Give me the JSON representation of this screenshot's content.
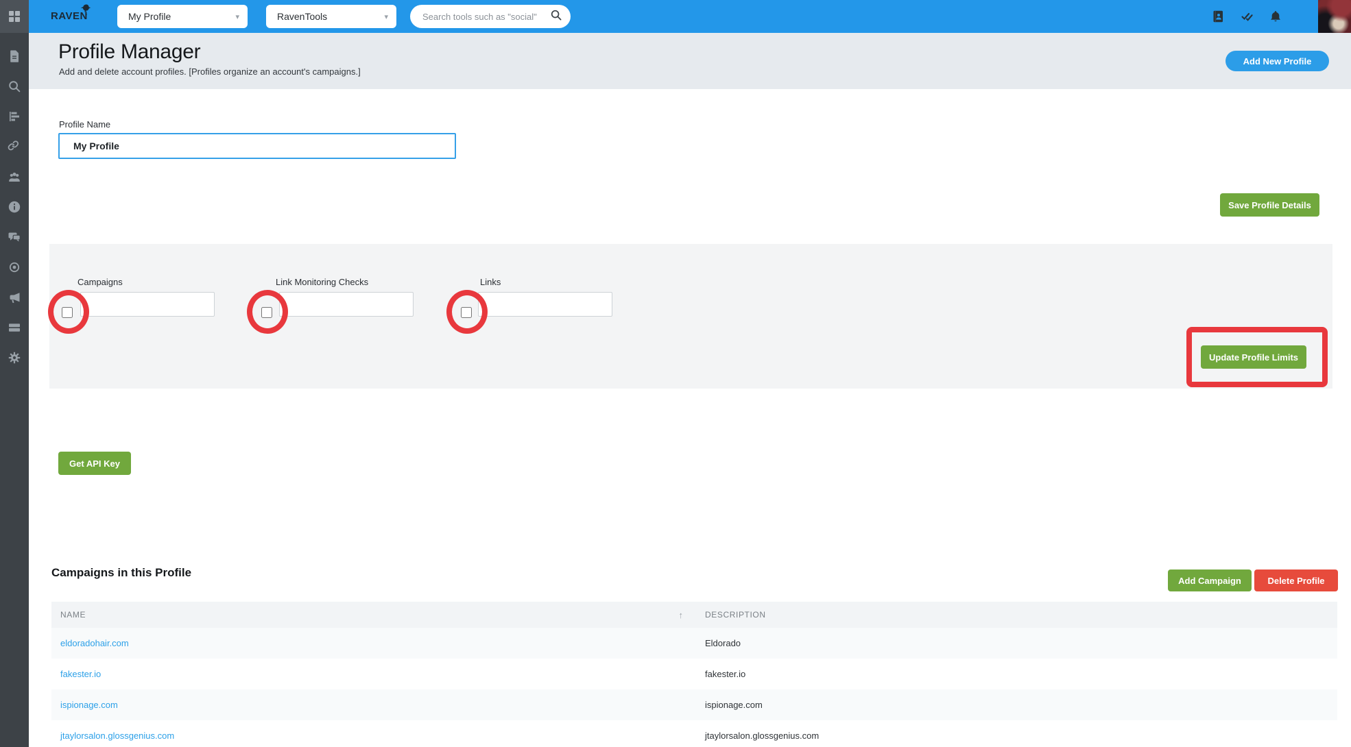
{
  "topbar": {
    "logo_text": "RAVEN",
    "profile_dropdown_value": "My Profile",
    "tools_dropdown_value": "RavenTools",
    "search_placeholder": "Search tools such as \"social\"",
    "dropdown_caret": "▾"
  },
  "header": {
    "title": "Profile Manager",
    "subtitle": "Add and delete account profiles. [Profiles organize an account's campaigns.]",
    "add_new_profile_button": "Add New Profile"
  },
  "profile_form": {
    "name_label": "Profile Name",
    "name_value": "My Profile",
    "save_button": "Save Profile Details"
  },
  "limits_panel": {
    "groups": [
      {
        "label": "Campaigns",
        "value": "",
        "checked": false
      },
      {
        "label": "Link Monitoring Checks",
        "value": "",
        "checked": false
      },
      {
        "label": "Links",
        "value": "",
        "checked": false
      }
    ],
    "update_button": "Update Profile Limits"
  },
  "api_section": {
    "get_api_key_button": "Get API Key"
  },
  "campaigns_section": {
    "heading": "Campaigns in this Profile",
    "add_campaign_button": "Add Campaign",
    "delete_profile_button": "Delete Profile"
  },
  "campaigns_table": {
    "columns": {
      "name": "NAME",
      "description": "DESCRIPTION"
    },
    "sort_indicator": "↑",
    "rows": [
      {
        "name": "eldoradohair.com",
        "description": "Eldorado"
      },
      {
        "name": "fakester.io",
        "description": "fakester.io"
      },
      {
        "name": "ispionage.com",
        "description": "ispionage.com"
      },
      {
        "name": "jtaylorsalon.glossgenius.com",
        "description": "jtaylorsalon.glossgenius.com"
      }
    ]
  },
  "annotations": {
    "highlight_color": "#e8383d",
    "circled_elements": [
      "Campaigns checkbox",
      "Link Monitoring Checks checkbox",
      "Links checkbox"
    ],
    "boxed_element": "Update Profile Limits button"
  },
  "colors": {
    "topbar_blue": "#2397e9",
    "green_button": "#71a83d",
    "red_button": "#e74b3c",
    "blue_button": "#2c9de8",
    "link_blue": "#2ca0e8",
    "sidebar_dark": "#3d4247"
  }
}
